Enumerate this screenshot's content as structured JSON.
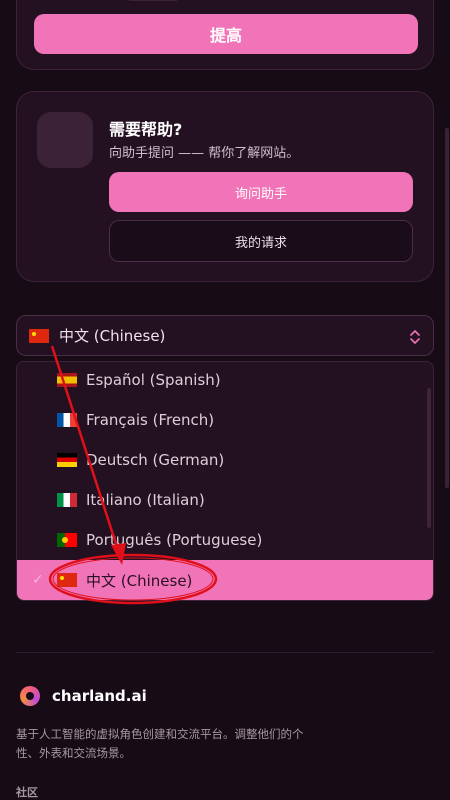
{
  "top": {
    "boost_label": "提高"
  },
  "help": {
    "title": "需要帮助?",
    "description": "向助手提问 —— 帮你了解网站。",
    "ask_label": "询问助手",
    "requests_label": "我的请求"
  },
  "language": {
    "selected_label": "中文 (Chinese)",
    "options": [
      {
        "label": "Español (Spanish)",
        "flag": "es"
      },
      {
        "label": "Français (French)",
        "flag": "fr"
      },
      {
        "label": "Deutsch (German)",
        "flag": "de"
      },
      {
        "label": "Italiano (Italian)",
        "flag": "it"
      },
      {
        "label": "Português (Portuguese)",
        "flag": "pt"
      },
      {
        "label": "中文 (Chinese)",
        "flag": "cn",
        "selected": true
      }
    ]
  },
  "footer": {
    "brand_name": "charland.ai",
    "description": "基于人工智能的虚拟角色创建和交流平台。调整他们的个性、外表和交流场景。",
    "community_heading": "社区"
  },
  "colors": {
    "accent": "#f274b8",
    "background": "#170b16",
    "card": "#231021",
    "annotation": "#e0101a"
  },
  "icons": [
    "check-icon",
    "chevrons-up-down-icon",
    "brand-logo-icon"
  ]
}
